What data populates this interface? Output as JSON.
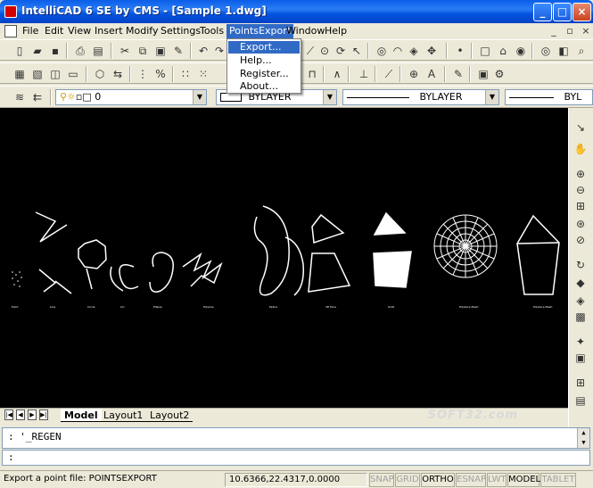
{
  "window": {
    "title": "IntelliCAD 6 SE by CMS - [Sample 1.dwg]"
  },
  "menu": [
    "File",
    "Edit",
    "View",
    "Insert",
    "Modify",
    "Settings",
    "Tools",
    "PointsExport",
    "Window",
    "Help"
  ],
  "points_export_menu": [
    "Export...",
    "Help...",
    "Register...",
    "About..."
  ],
  "properties_bar": {
    "layer": "0",
    "color": "BYLAYER",
    "linetype": "BYLAYER",
    "lineweight": "BYL"
  },
  "shape_labels": [
    "Point",
    "Line",
    "Circle",
    "Arc",
    "Ellipse",
    "Polyline",
    "Ppline",
    "3D Face",
    "Solid",
    "Polyface Mesh",
    "Polyface Mesh"
  ],
  "tabs": [
    "Model",
    "Layout1",
    "Layout2"
  ],
  "watermark": "SOFT32.com",
  "command": {
    "history": ": '_REGEN",
    "prompt": ":"
  },
  "status": {
    "message": "Export a point file: POINTSEXPORT",
    "coordinates": "10.6366,22.4317,0.0000",
    "toggles": [
      {
        "label": "SNAP",
        "on": false
      },
      {
        "label": "GRID",
        "on": false
      },
      {
        "label": "ORTHO",
        "on": true
      },
      {
        "label": "ESNAP",
        "on": false
      },
      {
        "label": "LWT",
        "on": false
      },
      {
        "label": "MODEL",
        "on": true
      },
      {
        "label": "TABLET",
        "on": false
      }
    ]
  },
  "icons": {
    "toolbar1": [
      "new-icon",
      "open-icon",
      "save-icon",
      "print-icon",
      "print-preview-icon",
      "cut-icon",
      "copy-icon",
      "paste-icon",
      "match-properties-icon",
      "undo-icon",
      "redo-icon"
    ],
    "right_toolbar": [
      "zoom-realtime-icon",
      "pan-icon",
      "zoom-in-icon",
      "zoom-out-icon",
      "zoom-window-icon",
      "zoom-extents-icon",
      "zoom-previous-icon",
      "orbit-icon",
      "render-icon",
      "shade-icon",
      "layers-icon",
      "properties-icon",
      "table-icon",
      "script-icon"
    ]
  }
}
